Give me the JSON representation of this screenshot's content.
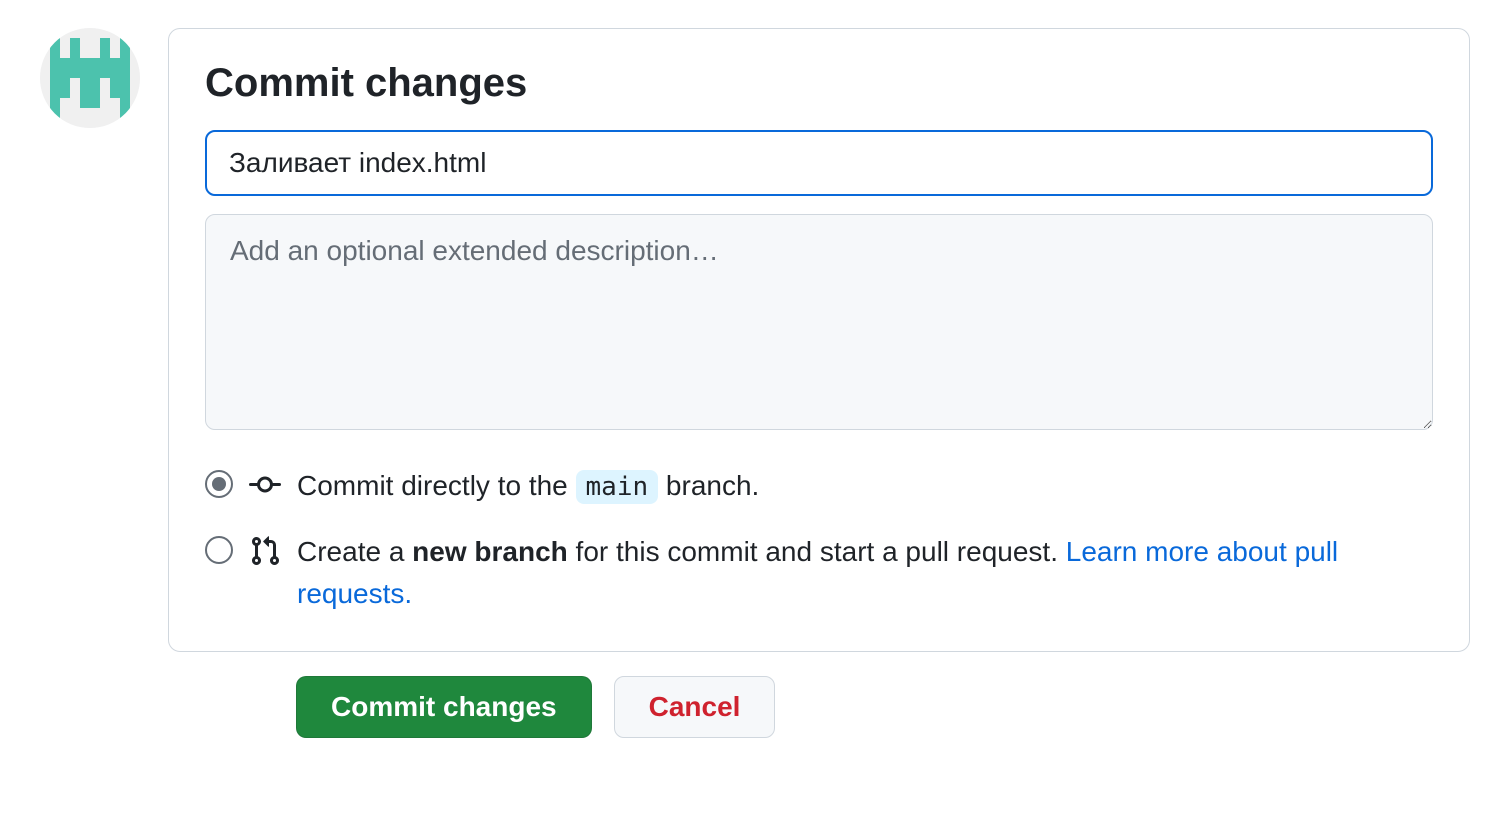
{
  "title": "Commit changes",
  "summary_value": "Заливает index.html",
  "description_placeholder": "Add an optional extended description…",
  "radio_direct": {
    "prefix": "Commit directly to the ",
    "branch": "main",
    "suffix": " branch."
  },
  "radio_pr": {
    "prefix": "Create a ",
    "bold": "new branch",
    "middle": " for this commit and start a pull request. ",
    "link": "Learn more about pull requests."
  },
  "buttons": {
    "commit": "Commit changes",
    "cancel": "Cancel"
  }
}
